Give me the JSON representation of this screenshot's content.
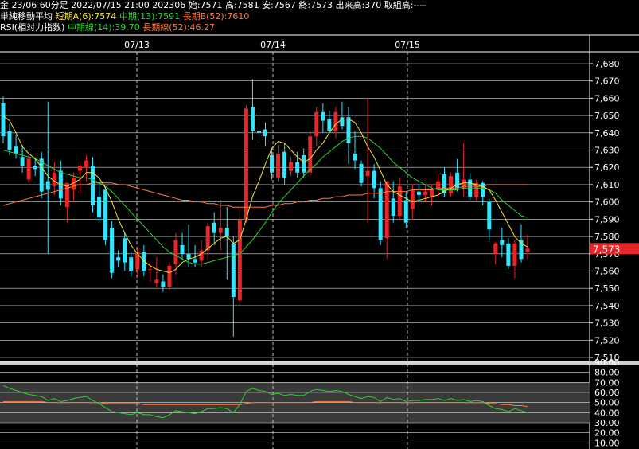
{
  "header": {
    "line1": "金 23/06 60分足 2022/07/15 21:00 202306 始:7571 高:7581 安:7567 終:7573 出来高:370 取組高:----",
    "ma_label": "単純移動平均",
    "ma_short": "短期A(6):7574",
    "ma_mid": "中期(13):7591",
    "ma_long": "長期B(52):7610",
    "rsi_label": "RSI(相対力指数)",
    "rsi_mid": "中期線(14):39.70",
    "rsi_long": "長期線(52):46.27"
  },
  "colors": {
    "up": "#e8262a",
    "down": "#33e4ff",
    "ma_short": "#f2e33a",
    "ma_mid": "#2fd12f",
    "ma_long": "#ff7a3d",
    "price_box": "#e8262a"
  },
  "chart_data": [
    {
      "type": "candlestick",
      "title": "金 23/06 60分足",
      "price_axis": {
        "min": 7510,
        "max": 7680,
        "step": 10
      },
      "x_dates": [
        "07/13",
        "07/14",
        "07/15"
      ],
      "last_price_label": "7,573",
      "candles": [
        {
          "o": 7657,
          "h": 7661,
          "l": 7634,
          "c": 7638
        },
        {
          "o": 7641,
          "h": 7645,
          "l": 7627,
          "c": 7630
        },
        {
          "o": 7632,
          "h": 7639,
          "l": 7625,
          "c": 7628
        },
        {
          "o": 7626,
          "h": 7633,
          "l": 7617,
          "c": 7621
        },
        {
          "o": 7613,
          "h": 7627,
          "l": 7611,
          "c": 7625
        },
        {
          "o": 7621,
          "h": 7626,
          "l": 7615,
          "c": 7619
        },
        {
          "o": 7625,
          "h": 7629,
          "l": 7602,
          "c": 7606
        },
        {
          "o": 7612,
          "h": 7658,
          "l": 7570,
          "c": 7607
        },
        {
          "o": 7609,
          "h": 7623,
          "l": 7604,
          "c": 7617
        },
        {
          "o": 7618,
          "h": 7624,
          "l": 7598,
          "c": 7602
        },
        {
          "o": 7597,
          "h": 7610,
          "l": 7588,
          "c": 7611
        },
        {
          "o": 7607,
          "h": 7617,
          "l": 7601,
          "c": 7614
        },
        {
          "o": 7618,
          "h": 7622,
          "l": 7605,
          "c": 7621
        },
        {
          "o": 7620,
          "h": 7627,
          "l": 7612,
          "c": 7624
        },
        {
          "o": 7621,
          "h": 7626,
          "l": 7594,
          "c": 7598
        },
        {
          "o": 7603,
          "h": 7610,
          "l": 7588,
          "c": 7591
        },
        {
          "o": 7607,
          "h": 7609,
          "l": 7575,
          "c": 7578
        },
        {
          "o": 7585,
          "h": 7589,
          "l": 7556,
          "c": 7559
        },
        {
          "o": 7568,
          "h": 7572,
          "l": 7562,
          "c": 7566
        },
        {
          "o": 7579,
          "h": 7582,
          "l": 7560,
          "c": 7565
        },
        {
          "o": 7568,
          "h": 7571,
          "l": 7557,
          "c": 7560
        },
        {
          "o": 7561,
          "h": 7574,
          "l": 7557,
          "c": 7571
        },
        {
          "o": 7571,
          "h": 7575,
          "l": 7557,
          "c": 7560
        },
        {
          "o": 7561,
          "h": 7565,
          "l": 7554,
          "c": 7561
        },
        {
          "o": 7553,
          "h": 7568,
          "l": 7551,
          "c": 7555
        },
        {
          "o": 7554,
          "h": 7558,
          "l": 7548,
          "c": 7551
        },
        {
          "o": 7551,
          "h": 7565,
          "l": 7549,
          "c": 7563
        },
        {
          "o": 7564,
          "h": 7582,
          "l": 7558,
          "c": 7578
        },
        {
          "o": 7575,
          "h": 7582,
          "l": 7567,
          "c": 7570
        },
        {
          "o": 7570,
          "h": 7587,
          "l": 7562,
          "c": 7567
        },
        {
          "o": 7567,
          "h": 7575,
          "l": 7562,
          "c": 7565
        },
        {
          "o": 7566,
          "h": 7578,
          "l": 7562,
          "c": 7572
        },
        {
          "o": 7572,
          "h": 7588,
          "l": 7566,
          "c": 7586
        },
        {
          "o": 7588,
          "h": 7594,
          "l": 7575,
          "c": 7582
        },
        {
          "o": 7582,
          "h": 7601,
          "l": 7572,
          "c": 7585
        },
        {
          "o": 7585,
          "h": 7597,
          "l": 7555,
          "c": 7580
        },
        {
          "o": 7576,
          "h": 7580,
          "l": 7522,
          "c": 7545
        },
        {
          "o": 7543,
          "h": 7597,
          "l": 7540,
          "c": 7590
        },
        {
          "o": 7590,
          "h": 7656,
          "l": 7588,
          "c": 7654
        },
        {
          "o": 7655,
          "h": 7671,
          "l": 7636,
          "c": 7641
        },
        {
          "o": 7641,
          "h": 7652,
          "l": 7634,
          "c": 7640
        },
        {
          "o": 7642,
          "h": 7646,
          "l": 7632,
          "c": 7638
        },
        {
          "o": 7627,
          "h": 7631,
          "l": 7613,
          "c": 7617
        },
        {
          "o": 7614,
          "h": 7633,
          "l": 7612,
          "c": 7628
        },
        {
          "o": 7629,
          "h": 7634,
          "l": 7610,
          "c": 7614
        },
        {
          "o": 7618,
          "h": 7626,
          "l": 7615,
          "c": 7623
        },
        {
          "o": 7623,
          "h": 7629,
          "l": 7614,
          "c": 7617
        },
        {
          "o": 7627,
          "h": 7631,
          "l": 7614,
          "c": 7617
        },
        {
          "o": 7617,
          "h": 7641,
          "l": 7615,
          "c": 7638
        },
        {
          "o": 7638,
          "h": 7655,
          "l": 7632,
          "c": 7652
        },
        {
          "o": 7652,
          "h": 7657,
          "l": 7640,
          "c": 7647
        },
        {
          "o": 7648,
          "h": 7653,
          "l": 7641,
          "c": 7641
        },
        {
          "o": 7641,
          "h": 7655,
          "l": 7637,
          "c": 7652
        },
        {
          "o": 7649,
          "h": 7658,
          "l": 7642,
          "c": 7644
        },
        {
          "o": 7649,
          "h": 7655,
          "l": 7622,
          "c": 7634
        },
        {
          "o": 7628,
          "h": 7641,
          "l": 7619,
          "c": 7624
        },
        {
          "o": 7622,
          "h": 7624,
          "l": 7609,
          "c": 7611
        },
        {
          "o": 7615,
          "h": 7660,
          "l": 7588,
          "c": 7618
        },
        {
          "o": 7618,
          "h": 7622,
          "l": 7602,
          "c": 7608
        },
        {
          "o": 7608,
          "h": 7612,
          "l": 7575,
          "c": 7578
        },
        {
          "o": 7579,
          "h": 7612,
          "l": 7567,
          "c": 7612
        },
        {
          "o": 7602,
          "h": 7612,
          "l": 7588,
          "c": 7592
        },
        {
          "o": 7592,
          "h": 7614,
          "l": 7590,
          "c": 7609
        },
        {
          "o": 7601,
          "h": 7606,
          "l": 7585,
          "c": 7588
        },
        {
          "o": 7596,
          "h": 7610,
          "l": 7590,
          "c": 7607
        },
        {
          "o": 7606,
          "h": 7610,
          "l": 7600,
          "c": 7604
        },
        {
          "o": 7604,
          "h": 7610,
          "l": 7600,
          "c": 7606
        },
        {
          "o": 7603,
          "h": 7610,
          "l": 7598,
          "c": 7607
        },
        {
          "o": 7608,
          "h": 7616,
          "l": 7603,
          "c": 7612
        },
        {
          "o": 7616,
          "h": 7620,
          "l": 7603,
          "c": 7605
        },
        {
          "o": 7605,
          "h": 7617,
          "l": 7603,
          "c": 7615
        },
        {
          "o": 7617,
          "h": 7625,
          "l": 7606,
          "c": 7608
        },
        {
          "o": 7608,
          "h": 7634,
          "l": 7603,
          "c": 7613
        },
        {
          "o": 7613,
          "h": 7617,
          "l": 7601,
          "c": 7603
        },
        {
          "o": 7603,
          "h": 7613,
          "l": 7601,
          "c": 7611
        },
        {
          "o": 7611,
          "h": 7612,
          "l": 7598,
          "c": 7603
        },
        {
          "o": 7600,
          "h": 7602,
          "l": 7578,
          "c": 7584
        },
        {
          "o": 7570,
          "h": 7577,
          "l": 7564,
          "c": 7576
        },
        {
          "o": 7578,
          "h": 7585,
          "l": 7568,
          "c": 7575
        },
        {
          "o": 7576,
          "h": 7579,
          "l": 7561,
          "c": 7563
        },
        {
          "o": 7563,
          "h": 7578,
          "l": 7556,
          "c": 7576
        },
        {
          "o": 7578,
          "h": 7587,
          "l": 7565,
          "c": 7567
        },
        {
          "o": 7571,
          "h": 7581,
          "l": 7567,
          "c": 7573
        }
      ],
      "ma_short_values": [
        7650,
        7647,
        7640,
        7632,
        7628,
        7625,
        7620,
        7615,
        7612,
        7610,
        7609,
        7611,
        7613,
        7617,
        7617,
        7614,
        7608,
        7600,
        7590,
        7582,
        7575,
        7570,
        7566,
        7563,
        7561,
        7560,
        7559,
        7561,
        7565,
        7567,
        7568,
        7570,
        7573,
        7576,
        7579,
        7580,
        7576,
        7578,
        7590,
        7603,
        7612,
        7622,
        7631,
        7635,
        7634,
        7630,
        7626,
        7623,
        7625,
        7630,
        7634,
        7640,
        7645,
        7648,
        7648,
        7646,
        7640,
        7632,
        7626,
        7618,
        7610,
        7606,
        7604,
        7602,
        7600,
        7601,
        7602,
        7603,
        7604,
        7606,
        7608,
        7610,
        7611,
        7611,
        7610,
        7609,
        7607,
        7601,
        7594,
        7587,
        7580,
        7576,
        7574
      ],
      "ma_mid_values": [
        7630,
        7629,
        7628,
        7627,
        7626,
        7625,
        7623,
        7621,
        7619,
        7617,
        7616,
        7615,
        7614,
        7614,
        7613,
        7611,
        7609,
        7606,
        7602,
        7598,
        7594,
        7590,
        7586,
        7582,
        7578,
        7574,
        7571,
        7569,
        7567,
        7565,
        7564,
        7564,
        7565,
        7566,
        7567,
        7568,
        7569,
        7570,
        7574,
        7578,
        7583,
        7588,
        7594,
        7599,
        7603,
        7607,
        7611,
        7615,
        7619,
        7622,
        7626,
        7629,
        7632,
        7635,
        7637,
        7638,
        7638,
        7637,
        7634,
        7631,
        7627,
        7623,
        7620,
        7617,
        7614,
        7612,
        7610,
        7608,
        7607,
        7607,
        7607,
        7607,
        7608,
        7608,
        7608,
        7608,
        7607,
        7605,
        7601,
        7598,
        7595,
        7592,
        7591
      ],
      "ma_long_values": [
        7598,
        7599,
        7600,
        7601,
        7602,
        7603,
        7604,
        7605,
        7606,
        7607,
        7608,
        7609,
        7610,
        7610,
        7611,
        7611,
        7611,
        7611,
        7610,
        7610,
        7609,
        7608,
        7607,
        7606,
        7605,
        7604,
        7603,
        7602,
        7601,
        7601,
        7600,
        7600,
        7599,
        7599,
        7598,
        7598,
        7597,
        7597,
        7597,
        7597,
        7597,
        7597,
        7598,
        7598,
        7599,
        7599,
        7600,
        7600,
        7601,
        7601,
        7602,
        7602,
        7603,
        7603,
        7604,
        7604,
        7604,
        7605,
        7605,
        7605,
        7606,
        7606,
        7606,
        7606,
        7607,
        7607,
        7607,
        7607,
        7608,
        7608,
        7608,
        7608,
        7609,
        7609,
        7609,
        7609,
        7610,
        7610,
        7610,
        7610,
        7610,
        7610,
        7610
      ]
    },
    {
      "type": "line",
      "title": "RSI(相対力指数)",
      "y_axis": {
        "min": 0,
        "max": 90,
        "labels": [
          "90.00",
          "80.00",
          "70.00",
          "60.00",
          "50.00",
          "40.00",
          "30.00",
          "20.00",
          "10.00"
        ]
      },
      "series": [
        {
          "name": "中期線(14)",
          "color": "#2fd12f",
          "values": [
            67,
            64,
            62,
            60,
            58,
            57,
            56,
            52,
            54,
            51,
            52,
            54,
            55,
            56,
            52,
            49,
            45,
            41,
            40,
            39,
            38,
            40,
            38,
            38,
            36,
            35,
            38,
            42,
            41,
            40,
            39,
            41,
            44,
            44,
            45,
            44,
            40,
            48,
            61,
            64,
            62,
            61,
            58,
            59,
            57,
            58,
            57,
            57,
            61,
            63,
            62,
            61,
            62,
            61,
            58,
            56,
            54,
            56,
            55,
            51,
            55,
            53,
            54,
            51,
            52,
            52,
            53,
            53,
            54,
            52,
            54,
            52,
            53,
            51,
            52,
            51,
            47,
            44,
            43,
            41,
            44,
            42,
            40
          ]
        },
        {
          "name": "長期線(52)",
          "color": "#ff7a3d",
          "values": [
            51,
            51,
            51,
            51,
            51,
            51,
            51,
            50,
            50,
            50,
            50,
            50,
            50,
            50,
            50,
            50,
            49,
            49,
            49,
            49,
            49,
            49,
            48,
            48,
            48,
            48,
            48,
            48,
            48,
            48,
            48,
            48,
            48,
            48,
            48,
            48,
            48,
            48,
            49,
            50,
            50,
            50,
            50,
            50,
            50,
            50,
            50,
            50,
            50,
            51,
            51,
            51,
            51,
            51,
            51,
            50,
            50,
            50,
            50,
            50,
            50,
            50,
            50,
            50,
            50,
            50,
            50,
            50,
            50,
            50,
            50,
            50,
            50,
            50,
            50,
            50,
            49,
            49,
            48,
            48,
            47,
            47,
            46
          ]
        }
      ]
    }
  ]
}
